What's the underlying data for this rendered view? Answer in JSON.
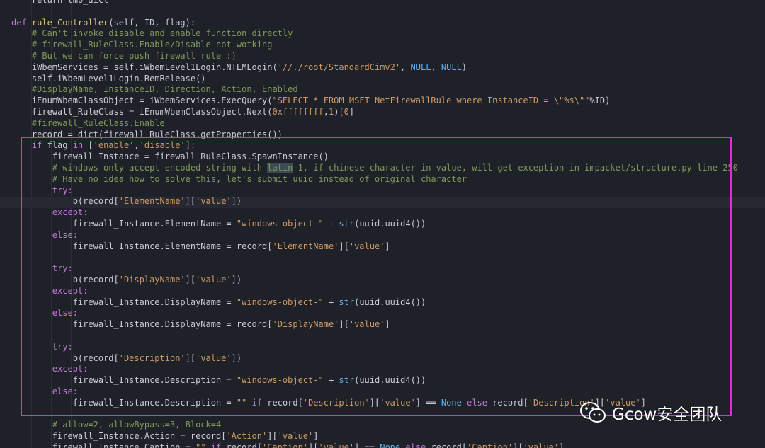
{
  "code_lines": [
    [
      {
        "c": "tx",
        "t": "    return tmp_dict"
      }
    ],
    [],
    [
      {
        "c": "kw",
        "t": "def "
      },
      {
        "c": "fn",
        "t": "rule_Controller"
      },
      {
        "c": "pn",
        "t": "(self, ID, flag):"
      }
    ],
    [
      {
        "c": "cm",
        "t": "    # Can't invoke disable and enable function directly"
      }
    ],
    [
      {
        "c": "cm",
        "t": "    # firewall_RuleClass.Enable/Disable not wotking"
      }
    ],
    [
      {
        "c": "cm",
        "t": "    # But we can force push firewall rule :)"
      }
    ],
    [
      {
        "c": "tx",
        "t": "    iWbemServices = self.iWbemLevel1Login.NTLMLogin("
      },
      {
        "c": "st",
        "t": "'//./root/StandardCimv2'"
      },
      {
        "c": "pn",
        "t": ", "
      },
      {
        "c": "bi",
        "t": "NULL"
      },
      {
        "c": "pn",
        "t": ", "
      },
      {
        "c": "bi",
        "t": "NULL"
      },
      {
        "c": "pn",
        "t": ")"
      }
    ],
    [
      {
        "c": "tx",
        "t": "    self.iWbemLevel1Login.RemRelease()"
      }
    ],
    [
      {
        "c": "cm",
        "t": "    #DisplayName, InstanceID, Direction, Action, Enabled"
      }
    ],
    [
      {
        "c": "tx",
        "t": "    iEnumWbemClassObject = iWbemServices.ExecQuery("
      },
      {
        "c": "st",
        "t": "\"SELECT * FROM MSFT_NetFirewallRule where InstanceID = \\\"%s\\\"\""
      },
      {
        "c": "pn",
        "t": "%ID)"
      }
    ],
    [
      {
        "c": "tx",
        "t": "    firewall_RuleClass = iEnumWbemClassObject.Next("
      },
      {
        "c": "nm",
        "t": "0xffffffff"
      },
      {
        "c": "pn",
        "t": ","
      },
      {
        "c": "nm",
        "t": "1"
      },
      {
        "c": "pn",
        "t": ")["
      },
      {
        "c": "nm",
        "t": "0"
      },
      {
        "c": "pn",
        "t": "]"
      }
    ],
    [
      {
        "c": "cm",
        "t": "    #firewall_RuleClass.Enable"
      }
    ],
    [
      {
        "c": "tx",
        "t": "    record = dict(firewall_RuleClass.getProperties())"
      }
    ],
    [
      {
        "c": "kw",
        "t": "    if "
      },
      {
        "c": "tx",
        "t": "flag "
      },
      {
        "c": "kw",
        "t": "in "
      },
      {
        "c": "pn",
        "t": "["
      },
      {
        "c": "st",
        "t": "'enable'"
      },
      {
        "c": "pn",
        "t": ","
      },
      {
        "c": "st",
        "t": "'disable'"
      },
      {
        "c": "pn",
        "t": "]:"
      }
    ],
    [
      {
        "c": "tx",
        "t": "        firewall_Instance = firewall_RuleClass.SpawnInstance()"
      }
    ],
    [
      {
        "c": "cm",
        "t": "        # windows only accept encoded string with "
      },
      {
        "c": "cm hl",
        "t": "latin"
      },
      {
        "c": "cm",
        "t": "-1, if chinese character in value, will get exception in impacket/structure.py line 250"
      }
    ],
    [
      {
        "c": "cm",
        "t": "        # Have no idea how to solve this, let's submit uuid instead of original character"
      }
    ],
    [
      {
        "c": "kw",
        "t": "        try:"
      }
    ],
    [
      {
        "c": "tx",
        "t": "            b(record["
      },
      {
        "c": "st",
        "t": "'ElementName'"
      },
      {
        "c": "pn",
        "t": "]["
      },
      {
        "c": "st",
        "t": "'value'"
      },
      {
        "c": "pn",
        "t": "])"
      }
    ],
    [
      {
        "c": "kw",
        "t": "        except:"
      }
    ],
    [
      {
        "c": "tx",
        "t": "            firewall_Instance.ElementName = "
      },
      {
        "c": "st",
        "t": "\"windows-object-\""
      },
      {
        "c": "pn",
        "t": " + "
      },
      {
        "c": "bi",
        "t": "str"
      },
      {
        "c": "pn",
        "t": "(uuid.uuid4())"
      }
    ],
    [
      {
        "c": "kw",
        "t": "        else:"
      }
    ],
    [
      {
        "c": "tx",
        "t": "            firewall_Instance.ElementName = record["
      },
      {
        "c": "st",
        "t": "'ElementName'"
      },
      {
        "c": "pn",
        "t": "]["
      },
      {
        "c": "st",
        "t": "'value'"
      },
      {
        "c": "pn",
        "t": "]"
      }
    ],
    [],
    [
      {
        "c": "kw",
        "t": "        try:"
      }
    ],
    [
      {
        "c": "tx",
        "t": "            b(record["
      },
      {
        "c": "st",
        "t": "'DisplayName'"
      },
      {
        "c": "pn",
        "t": "]["
      },
      {
        "c": "st",
        "t": "'value'"
      },
      {
        "c": "pn",
        "t": "])"
      }
    ],
    [
      {
        "c": "kw",
        "t": "        except:"
      }
    ],
    [
      {
        "c": "tx",
        "t": "            firewall_Instance.DisplayName = "
      },
      {
        "c": "st",
        "t": "\"windows-object-\""
      },
      {
        "c": "pn",
        "t": " + "
      },
      {
        "c": "bi",
        "t": "str"
      },
      {
        "c": "pn",
        "t": "(uuid.uuid4())"
      }
    ],
    [
      {
        "c": "kw",
        "t": "        else:"
      }
    ],
    [
      {
        "c": "tx",
        "t": "            firewall_Instance.DisplayName = record["
      },
      {
        "c": "st",
        "t": "'DisplayName'"
      },
      {
        "c": "pn",
        "t": "]["
      },
      {
        "c": "st",
        "t": "'value'"
      },
      {
        "c": "pn",
        "t": "]"
      }
    ],
    [],
    [
      {
        "c": "kw",
        "t": "        try:"
      }
    ],
    [
      {
        "c": "tx",
        "t": "            b(record["
      },
      {
        "c": "st",
        "t": "'Description'"
      },
      {
        "c": "pn",
        "t": "]["
      },
      {
        "c": "st",
        "t": "'value'"
      },
      {
        "c": "pn",
        "t": "])"
      }
    ],
    [
      {
        "c": "kw",
        "t": "        except:"
      }
    ],
    [
      {
        "c": "tx",
        "t": "            firewall_Instance.Description = "
      },
      {
        "c": "st",
        "t": "\"windows-object-\""
      },
      {
        "c": "pn",
        "t": " + "
      },
      {
        "c": "bi",
        "t": "str"
      },
      {
        "c": "pn",
        "t": "(uuid.uuid4())"
      }
    ],
    [
      {
        "c": "kw",
        "t": "        else:"
      }
    ],
    [
      {
        "c": "tx",
        "t": "            firewall_Instance.Description = "
      },
      {
        "c": "st",
        "t": "\"\""
      },
      {
        "c": "pn",
        "t": " "
      },
      {
        "c": "kw",
        "t": "if "
      },
      {
        "c": "tx",
        "t": "record["
      },
      {
        "c": "st",
        "t": "'Description'"
      },
      {
        "c": "pn",
        "t": "]["
      },
      {
        "c": "st",
        "t": "'value'"
      },
      {
        "c": "pn",
        "t": "] == "
      },
      {
        "c": "bi",
        "t": "None"
      },
      {
        "c": "kw",
        "t": " else "
      },
      {
        "c": "tx",
        "t": "record["
      },
      {
        "c": "st",
        "t": "'Description'"
      },
      {
        "c": "pn",
        "t": "]["
      },
      {
        "c": "st",
        "t": "'value'"
      },
      {
        "c": "pn",
        "t": "]"
      }
    ],
    [],
    [
      {
        "c": "cm",
        "t": "        # allow=2, allowBypass=3, Block=4"
      }
    ],
    [
      {
        "c": "tx",
        "t": "        firewall_Instance.Action = record["
      },
      {
        "c": "st",
        "t": "'Action'"
      },
      {
        "c": "pn",
        "t": "]["
      },
      {
        "c": "st",
        "t": "'value'"
      },
      {
        "c": "pn",
        "t": "]"
      }
    ],
    [
      {
        "c": "tx",
        "t": "        firewall_Instance.Caption = "
      },
      {
        "c": "st",
        "t": "\"\""
      },
      {
        "c": "pn",
        "t": " "
      },
      {
        "c": "kw",
        "t": "if "
      },
      {
        "c": "tx",
        "t": "record["
      },
      {
        "c": "st",
        "t": "'Caption'"
      },
      {
        "c": "pn",
        "t": "]["
      },
      {
        "c": "st",
        "t": "'value'"
      },
      {
        "c": "pn",
        "t": "] == "
      },
      {
        "c": "bi",
        "t": "None"
      },
      {
        "c": "kw",
        "t": " else "
      },
      {
        "c": "tx",
        "t": "record["
      },
      {
        "c": "st",
        "t": "'Caption'"
      },
      {
        "c": "pn",
        "t": "]["
      },
      {
        "c": "st",
        "t": "'value'"
      },
      {
        "c": "pn",
        "t": "]"
      }
    ]
  ],
  "watermark": {
    "text": "Gcow安全团队",
    "icon": "wechat-icon"
  },
  "colors": {
    "background": "#1f2128",
    "keyword": "#c678dd",
    "function": "#e5c07b",
    "comment": "#7f9a5b",
    "string": "#d19a66",
    "builtin": "#61afef",
    "text": "#c9ccd4",
    "selection_box": "#d92fd3"
  }
}
